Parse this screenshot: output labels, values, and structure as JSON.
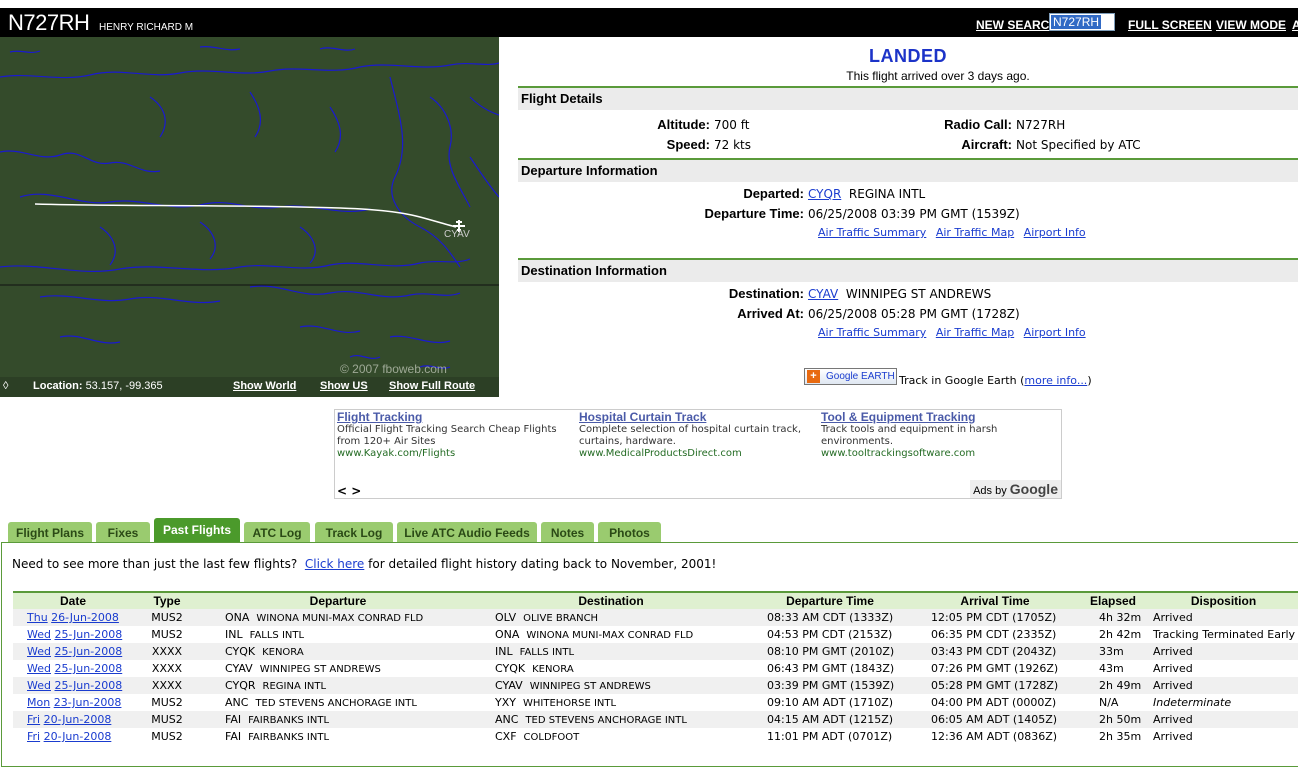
{
  "header": {
    "tail_number": "N727RH",
    "owner": "HENRY RICHARD M",
    "new_search_label": "NEW SEARCH",
    "search_value": "N727RH",
    "full_screen_label": "FULL SCREEN",
    "view_mode_label": "VIEW MODE",
    "cut_label": "A"
  },
  "map": {
    "airport_label": "CYAV",
    "copyright": "© 2007 fboweb.com",
    "location_label": "Location:",
    "location_value": "53.157, -99.365",
    "corner_glyph": "◊",
    "show_world": "Show World",
    "show_us": "Show US",
    "show_full_route": "Show Full Route",
    "background_color": "#344b2b",
    "border_color": "#1a1ad0",
    "track_color": "#ffffff"
  },
  "status": {
    "title": "LANDED",
    "subtitle": "This flight arrived over 3 days ago.",
    "title_color": "#1c33c8"
  },
  "flight_details": {
    "heading": "Flight Details",
    "altitude_label": "Altitude:",
    "altitude_value": "700 ft",
    "speed_label": "Speed:",
    "speed_value": "72 kts",
    "radio_call_label": "Radio Call:",
    "radio_call_value": "N727RH",
    "aircraft_label": "Aircraft:",
    "aircraft_value": "Not Specified by ATC"
  },
  "departure": {
    "heading": "Departure Information",
    "departed_label": "Departed:",
    "airport_code": "CYQR",
    "airport_name": "REGINA INTL",
    "time_label": "Departure Time:",
    "time_value": "06/25/2008 03:39 PM GMT (1539Z)",
    "links": [
      "Air Traffic Summary",
      "Air Traffic Map",
      "Airport Info"
    ]
  },
  "destination": {
    "heading": "Destination Information",
    "destination_label": "Destination:",
    "airport_code": "CYAV",
    "airport_name": "WINNIPEG ST ANDREWS",
    "arrived_label": "Arrived At:",
    "arrived_value": "06/25/2008 05:28 PM GMT (1728Z)",
    "links": [
      "Air Traffic Summary",
      "Air Traffic Map",
      "Airport Info"
    ]
  },
  "google_earth": {
    "button_label": "Google EARTH",
    "text": "Track in Google Earth (",
    "more_info": "more info...",
    "close_paren": ")"
  },
  "ads": {
    "items": [
      {
        "title": "Flight Tracking",
        "desc": "Official Flight Tracking Search Cheap Flights from 120+ Air Sites",
        "url": "www.Kayak.com/Flights"
      },
      {
        "title": "Hospital Curtain Track",
        "desc": "Complete selection of hospital curtain track, curtains, hardware.",
        "url": "www.MedicalProductsDirect.com"
      },
      {
        "title": "Tool & Equipment Tracking",
        "desc": "Track tools and equipment in harsh environments.",
        "url": "www.tooltrackingsoftware.com"
      }
    ],
    "arrows": "< >",
    "ads_by": "Ads by",
    "google": "Google"
  },
  "tabs": [
    {
      "label": "Flight Plans",
      "active": false
    },
    {
      "label": "Fixes",
      "active": false
    },
    {
      "label": "Past Flights",
      "active": true
    },
    {
      "label": "ATC Log",
      "active": false
    },
    {
      "label": "Track Log",
      "active": false
    },
    {
      "label": "Live ATC Audio Feeds",
      "active": false
    },
    {
      "label": "Notes",
      "active": false
    },
    {
      "label": "Photos",
      "active": false
    }
  ],
  "history_note": {
    "prefix": "Need to see more than just the last few flights?",
    "link": "Click here",
    "suffix": "for detailed flight history dating back to November, 2001!"
  },
  "past_flights": {
    "columns": [
      "Date",
      "Type",
      "Departure",
      "Destination",
      "Departure Time",
      "Arrival Time",
      "Elapsed",
      "Disposition"
    ],
    "rows": [
      {
        "day": "Thu",
        "date": "26-Jun-2008",
        "type": "MUS2",
        "dep_code": "ONA",
        "dep_name": "WINONA MUNI-MAX CONRAD FLD",
        "dest_code": "OLV",
        "dest_name": "OLIVE BRANCH",
        "dep_time": "08:33 AM CDT (1333Z)",
        "arr_time": "12:05 PM CDT (1705Z)",
        "elapsed": "4h 32m",
        "disposition": "Arrived",
        "italic": false
      },
      {
        "day": "Wed",
        "date": "25-Jun-2008",
        "type": "MUS2",
        "dep_code": "INL",
        "dep_name": "FALLS INTL",
        "dest_code": "ONA",
        "dest_name": "WINONA MUNI-MAX CONRAD FLD",
        "dep_time": "04:53 PM CDT (2153Z)",
        "arr_time": "06:35 PM CDT (2335Z)",
        "elapsed": "2h 42m",
        "disposition": "Tracking Terminated Early",
        "italic": false
      },
      {
        "day": "Wed",
        "date": "25-Jun-2008",
        "type": "XXXX",
        "dep_code": "CYQK",
        "dep_name": "KENORA",
        "dest_code": "INL",
        "dest_name": "FALLS INTL",
        "dep_time": "08:10 PM GMT (2010Z)",
        "arr_time": "03:43 PM CDT (2043Z)",
        "elapsed": "33m",
        "disposition": "Arrived",
        "italic": false
      },
      {
        "day": "Wed",
        "date": "25-Jun-2008",
        "type": "XXXX",
        "dep_code": "CYAV",
        "dep_name": "WINNIPEG ST ANDREWS",
        "dest_code": "CYQK",
        "dest_name": "KENORA",
        "dep_time": "06:43 PM GMT (1843Z)",
        "arr_time": "07:26 PM GMT (1926Z)",
        "elapsed": "43m",
        "disposition": "Arrived",
        "italic": false
      },
      {
        "day": "Wed",
        "date": "25-Jun-2008",
        "type": "XXXX",
        "dep_code": "CYQR",
        "dep_name": "REGINA INTL",
        "dest_code": "CYAV",
        "dest_name": "WINNIPEG ST ANDREWS",
        "dep_time": "03:39 PM GMT (1539Z)",
        "arr_time": "05:28 PM GMT (1728Z)",
        "elapsed": "2h 49m",
        "disposition": "Arrived",
        "italic": false
      },
      {
        "day": "Mon",
        "date": "23-Jun-2008",
        "type": "MUS2",
        "dep_code": "ANC",
        "dep_name": "TED STEVENS ANCHORAGE INTL",
        "dest_code": "YXY",
        "dest_name": "WHITEHORSE INTL",
        "dep_time": "09:10 AM ADT (1710Z)",
        "arr_time": "04:00 PM ADT (0000Z)",
        "elapsed": "N/A",
        "disposition": "Indeterminate",
        "italic": true
      },
      {
        "day": "Fri",
        "date": "20-Jun-2008",
        "type": "MUS2",
        "dep_code": "FAI",
        "dep_name": "FAIRBANKS INTL",
        "dest_code": "ANC",
        "dest_name": "TED STEVENS ANCHORAGE INTL",
        "dep_time": "04:15 AM ADT (1215Z)",
        "arr_time": "06:05 AM ADT (1405Z)",
        "elapsed": "2h 50m",
        "disposition": "Arrived",
        "italic": false
      },
      {
        "day": "Fri",
        "date": "20-Jun-2008",
        "type": "MUS2",
        "dep_code": "FAI",
        "dep_name": "FAIRBANKS INTL",
        "dest_code": "CXF",
        "dest_name": "COLDFOOT",
        "dep_time": "11:01 PM ADT (0701Z)",
        "arr_time": "12:36 AM ADT (0836Z)",
        "elapsed": "2h 35m",
        "disposition": "Arrived",
        "italic": false
      }
    ]
  }
}
